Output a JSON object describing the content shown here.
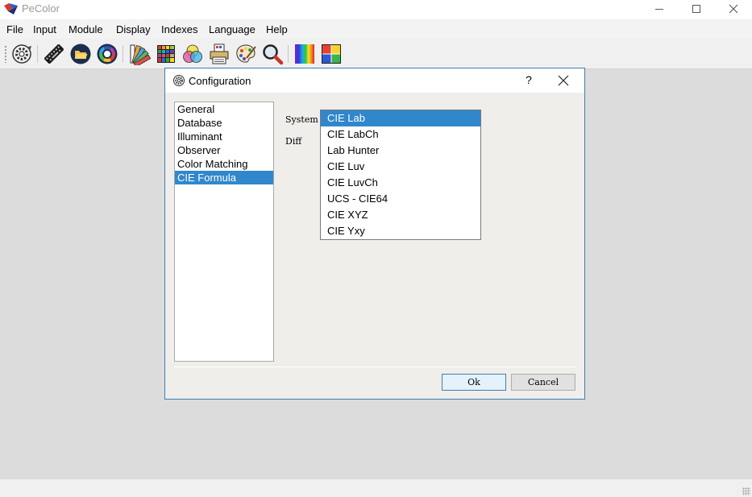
{
  "window": {
    "title": "PeColor"
  },
  "menu": [
    "File",
    "Input",
    "Module",
    "Display",
    "Indexes",
    "Language",
    "Help"
  ],
  "toolbar": {
    "buttons": [
      "settings-gear-icon",
      "keyboard-icon",
      "folder-open-icon",
      "color-wheel-icon",
      "color-fan-icon",
      "color-palette-grid-icon",
      "rgb-circles-icon",
      "printer-icon",
      "paint-palette-icon",
      "magnifier-icon",
      "spectrum-icon",
      "color-chart-icon"
    ]
  },
  "dialog": {
    "title": "Configuration",
    "help": "?",
    "categories": [
      "General",
      "Database",
      "Illuminant",
      "Observer",
      "Color Matching",
      "CIE Formula"
    ],
    "selected_category": "CIE Formula",
    "system_label": "System",
    "diff_label": "Diff",
    "system_options": [
      "CIE Lab",
      "CIE LabCh",
      "Lab Hunter",
      "CIE Luv",
      "CIE LuvCh",
      "UCS - CIE64",
      "CIE XYZ",
      "CIE Yxy"
    ],
    "selected_system": "CIE Lab",
    "ok_label": "Ok",
    "cancel_label": "Cancel"
  },
  "colors": {
    "accent": "#3087cb",
    "dialog_border": "#3c7fb1",
    "workspace": "#dcdcdc"
  }
}
